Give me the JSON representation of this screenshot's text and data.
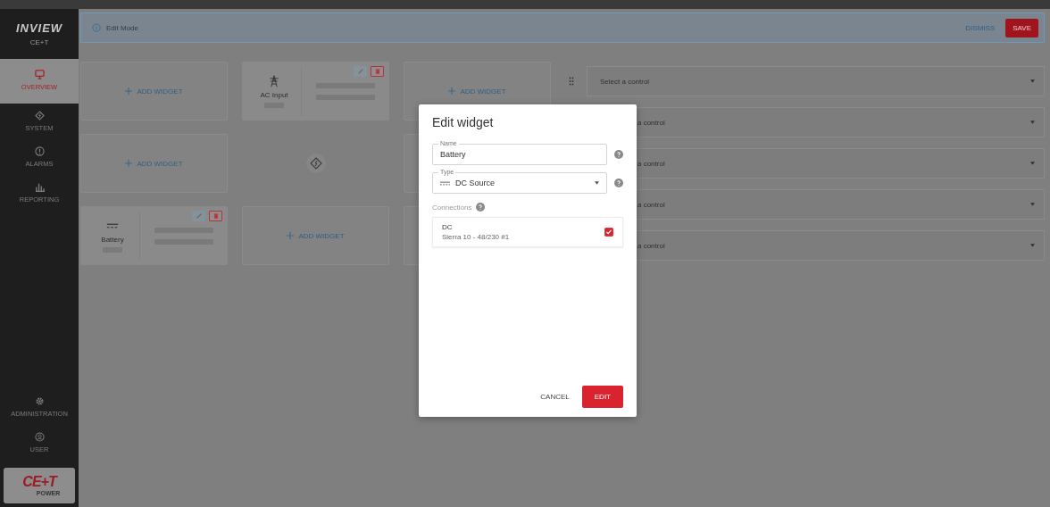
{
  "sidebar": {
    "brand": "INVIEW",
    "subtitle": "CE+T",
    "items": [
      {
        "label": "OVERVIEW",
        "selected": true
      },
      {
        "label": "SYSTEM",
        "selected": false
      },
      {
        "label": "ALARMS",
        "selected": false
      },
      {
        "label": "REPORTING",
        "selected": false
      }
    ],
    "bottom_items": [
      {
        "label": "ADMINISTRATION"
      },
      {
        "label": "USER"
      }
    ],
    "logo": {
      "text": "CE+T",
      "subtext": "POWER"
    }
  },
  "edit_bar": {
    "label": "Edit Mode",
    "dismiss": "DISMISS",
    "save": "SAVE"
  },
  "grid": [
    {
      "kind": "add",
      "label": "ADD WIDGET"
    },
    {
      "kind": "ac_widget",
      "name": "AC Input"
    },
    {
      "kind": "add",
      "label": "ADD WIDGET"
    },
    {
      "kind": "add",
      "label": "ADD WIDGET"
    },
    {
      "kind": "center"
    },
    {
      "kind": "covered"
    },
    {
      "kind": "dc_widget",
      "name": "Battery"
    },
    {
      "kind": "add",
      "label": "ADD WIDGET"
    },
    {
      "kind": "covered"
    }
  ],
  "controls": [
    {
      "placeholder": "Select a control"
    },
    {
      "placeholder": "a control"
    },
    {
      "placeholder": "a control"
    },
    {
      "placeholder": "a control"
    },
    {
      "placeholder": "a control"
    }
  ],
  "dialog": {
    "title": "Edit widget",
    "name_field": {
      "label": "Name",
      "value": "Battery"
    },
    "type_field": {
      "label": "Type",
      "value": "DC Source"
    },
    "connections_label": "Connections",
    "connections": [
      {
        "title": "DC",
        "subtitle": "Sierra 10 - 48/230 #1",
        "checked": true
      }
    ],
    "cancel": "CANCEL",
    "confirm": "EDIT"
  }
}
